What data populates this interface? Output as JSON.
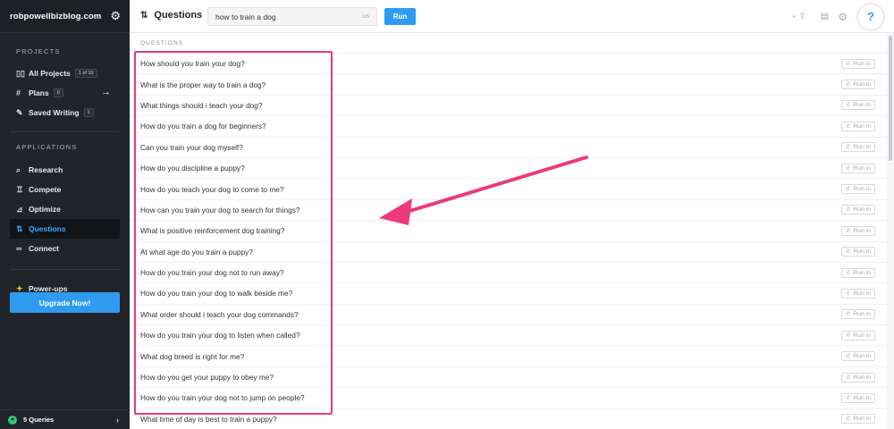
{
  "sidebar": {
    "domain": "robpowellbizblog.com",
    "projects_heading": "PROJECTS",
    "projects": [
      {
        "label": "All Projects",
        "badge": "1 of 10",
        "icon": "columns-icon"
      },
      {
        "label": "Plans",
        "badge": "0",
        "icon": "hash-icon"
      },
      {
        "label": "Saved Writing",
        "badge": "1",
        "icon": "edit-icon"
      }
    ],
    "applications_heading": "APPLICATIONS",
    "applications": [
      {
        "label": "Research",
        "icon": "search-icon"
      },
      {
        "label": "Compete",
        "icon": "trophy-icon"
      },
      {
        "label": "Optimize",
        "icon": "sliders-icon"
      },
      {
        "label": "Questions",
        "icon": "questions-icon",
        "active": true
      },
      {
        "label": "Connect",
        "icon": "link-icon"
      }
    ],
    "powerups": "Power-ups",
    "upgrade": "Upgrade Now!",
    "queries": "5 Queries"
  },
  "topbar": {
    "title": "Questions",
    "search_value": "how to train a dog",
    "country": "US",
    "run_label": "Run",
    "help": "?"
  },
  "table": {
    "column_header": "QUESTIONS",
    "action_label": "Run in",
    "rows": [
      "How should you train your dog?",
      "What is the proper way to train a dog?",
      "What things should i teach your dog?",
      "How do you train a dog for beginners?",
      "Can you train your dog myself?",
      "How do you discipline a puppy?",
      "How do you teach your dog to come to me?",
      "How can you train your dog to search for things?",
      "What is positive reinforcement dog training?",
      "At what age do you train a puppy?",
      "How do you train your dog not to run away?",
      "How do you train your dog to walk beside me?",
      "What order should i teach your dog commands?",
      "How do you train your dog to listen when called?",
      "What dog breed is right for me?",
      "How do you get your puppy to obey me?",
      "How do you train your dog not to jump on people?",
      "What time of day is best to train a puppy?"
    ]
  },
  "colors": {
    "sidebar_bg": "#21252b",
    "accent": "#2f9bf0",
    "annotation": "#ec3a7c"
  }
}
